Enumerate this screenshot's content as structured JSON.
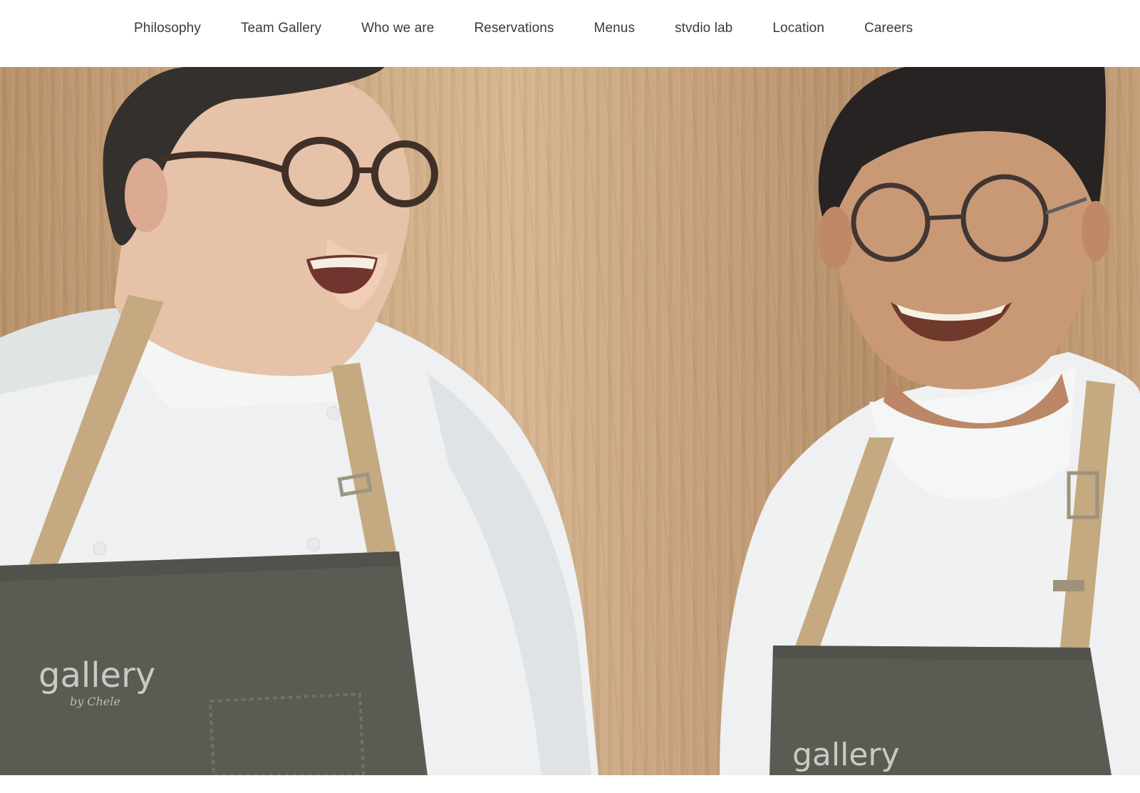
{
  "nav": {
    "items": [
      {
        "label": "Philosophy"
      },
      {
        "label": "Team Gallery"
      },
      {
        "label": "Who we are"
      },
      {
        "label": "Reservations"
      },
      {
        "label": "Menus"
      },
      {
        "label": "stvdio lab"
      },
      {
        "label": "Location"
      },
      {
        "label": "Careers"
      }
    ]
  },
  "hero": {
    "apron_logo_left": "gallery",
    "apron_logo_left_sub": "by Chele",
    "apron_logo_right": "gallery"
  },
  "colors": {
    "nav_text": "#3a3a3a",
    "background": "#ffffff",
    "apron": "#55574f",
    "strap": "#c4a77c",
    "coat": "#eef0f0"
  }
}
